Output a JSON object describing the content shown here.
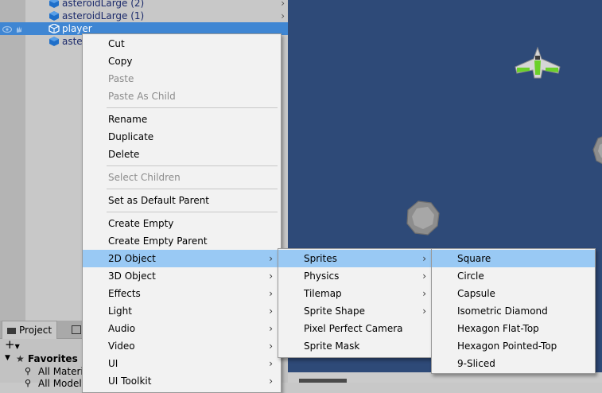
{
  "hierarchy": {
    "items": [
      {
        "label": "asteroidLarge (2)"
      },
      {
        "label": "asteroidLarge (1)"
      },
      {
        "label": "player"
      },
      {
        "label": "aste"
      }
    ]
  },
  "project": {
    "tabs": [
      "Project"
    ],
    "add_label": "+",
    "favorites_label": "Favorites",
    "favorites_items": [
      "All Materi",
      "All Model"
    ]
  },
  "context_menu": {
    "items": [
      {
        "label": "Cut"
      },
      {
        "label": "Copy"
      },
      {
        "label": "Paste"
      },
      {
        "label": "Paste As Child"
      },
      {
        "label": "Rename"
      },
      {
        "label": "Duplicate"
      },
      {
        "label": "Delete"
      },
      {
        "label": "Select Children"
      },
      {
        "label": "Set as Default Parent"
      },
      {
        "label": "Create Empty"
      },
      {
        "label": "Create Empty Parent"
      },
      {
        "label": "2D Object"
      },
      {
        "label": "3D Object"
      },
      {
        "label": "Effects"
      },
      {
        "label": "Light"
      },
      {
        "label": "Audio"
      },
      {
        "label": "Video"
      },
      {
        "label": "UI"
      },
      {
        "label": "UI Toolkit"
      }
    ]
  },
  "submenu_2d": {
    "items": [
      {
        "label": "Sprites"
      },
      {
        "label": "Physics"
      },
      {
        "label": "Tilemap"
      },
      {
        "label": "Sprite Shape"
      },
      {
        "label": "Pixel Perfect Camera"
      },
      {
        "label": "Sprite Mask"
      }
    ]
  },
  "submenu_sprites": {
    "items": [
      {
        "label": "Square"
      },
      {
        "label": "Circle"
      },
      {
        "label": "Capsule"
      },
      {
        "label": "Isometric Diamond"
      },
      {
        "label": "Hexagon Flat-Top"
      },
      {
        "label": "Hexagon Pointed-Top"
      },
      {
        "label": "9-Sliced"
      }
    ]
  },
  "colors": {
    "scene_background": "#2e4a78",
    "selection": "#3f86d3",
    "menu_highlight": "#99c9f4"
  }
}
